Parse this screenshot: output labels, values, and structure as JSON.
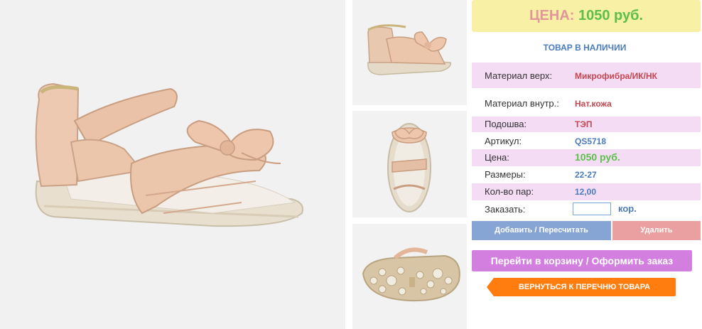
{
  "product": {
    "price_label": "ЦЕНА:",
    "price_value": "1050 руб.",
    "stock_status": "ТОВАР В НАЛИЧИИ"
  },
  "specs": [
    {
      "label": "Материал верх:",
      "value": "Микрофибра/ИК/НК"
    },
    {
      "label": "Материал внутр.:",
      "value": "Нат.кожа"
    },
    {
      "label": "Подошва:",
      "value": "ТЭП"
    },
    {
      "label": "Артикул:",
      "value": "QS5718"
    },
    {
      "label": "Цена:",
      "value": "1050 руб."
    },
    {
      "label": "Размеры:",
      "value": "22-27"
    },
    {
      "label": "Кол-во пар:",
      "value": "12,00"
    }
  ],
  "order": {
    "label": "Заказать:",
    "quantity_value": "",
    "unit": "кор."
  },
  "actions": {
    "update_label": "Добавить / Пересчитать",
    "delete_label": "Удалить",
    "cart_label": "Перейти в корзину / Оформить заказ",
    "back_label": "ВЕРНУТЬСЯ К ПЕРЕЧНЮ ТОВАРА"
  },
  "images": {
    "main": "sandal-side-view",
    "thumbs": [
      "sandal-angled-view",
      "sandal-top-view",
      "sandal-sole-view"
    ]
  },
  "colors": {
    "price_box": "#f7f0a5",
    "price_label": "#e2969a",
    "price_value": "#5cbf4a",
    "row_highlight": "#f4dcf5",
    "update_button": "#86a5d4",
    "delete_button": "#eaa0a0",
    "cart_button": "#d37fe0",
    "back_button": "#ff7d0f"
  }
}
